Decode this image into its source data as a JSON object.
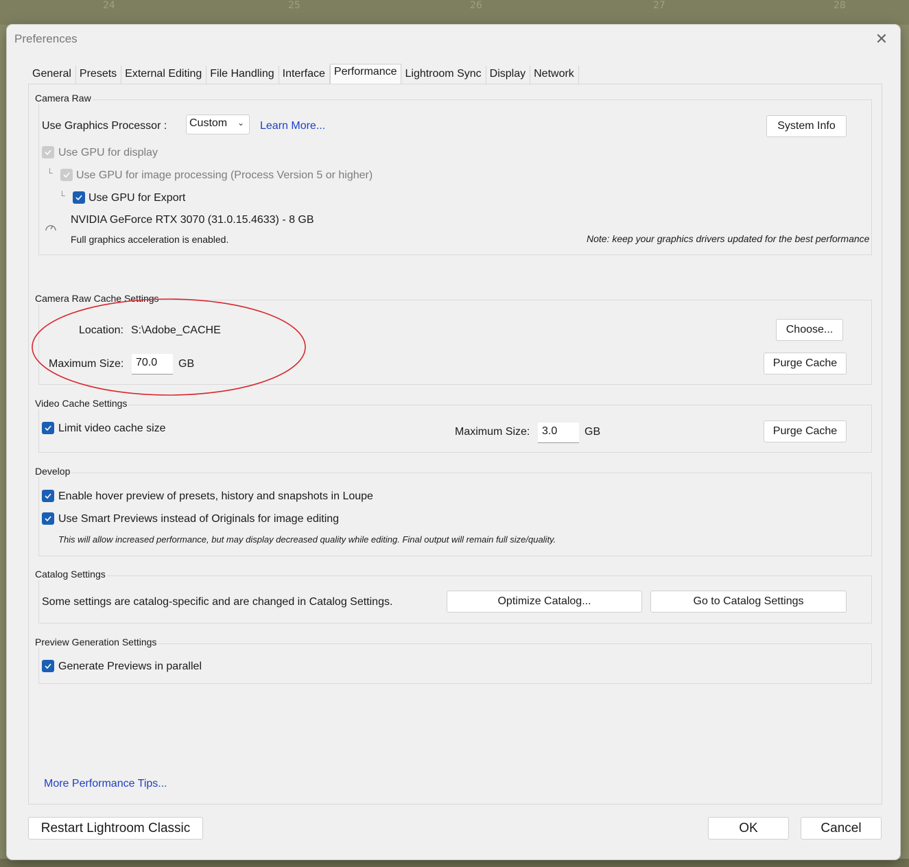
{
  "dialog": {
    "title": "Preferences"
  },
  "tabs": [
    "General",
    "Presets",
    "External Editing",
    "File Handling",
    "Interface",
    "Performance",
    "Lightroom Sync",
    "Display",
    "Network"
  ],
  "camera_raw": {
    "label": "Camera Raw",
    "gpu_label": "Use Graphics Processor :",
    "gpu_value": "Custom",
    "learn_more": "Learn More...",
    "system_info": "System Info",
    "use_gpu_display": "Use GPU for display",
    "use_gpu_processing": "Use GPU for image processing (Process Version 5 or higher)",
    "use_gpu_export": "Use GPU for Export",
    "gpu_name": "NVIDIA GeForce RTX 3070 (31.0.15.4633) - 8 GB",
    "accel_status": "Full graphics acceleration is enabled.",
    "note": "Note: keep your graphics drivers updated for the best performance"
  },
  "cache": {
    "label": "Camera Raw Cache Settings",
    "location_label": "Location:",
    "location_value": "S:\\Adobe_CACHE",
    "choose": "Choose...",
    "max_label": "Maximum Size:",
    "max_value": "70.0",
    "unit": "GB",
    "purge": "Purge Cache"
  },
  "video_cache": {
    "label": "Video Cache Settings",
    "limit": "Limit video cache size",
    "max_label": "Maximum Size:",
    "max_value": "3.0",
    "unit": "GB",
    "purge": "Purge Cache"
  },
  "develop": {
    "label": "Develop",
    "hover": "Enable hover preview of presets, history and snapshots in Loupe",
    "smart": "Use Smart Previews instead of Originals for image editing",
    "smart_note": "This will allow increased performance, but may display decreased quality while editing. Final output will remain full size/quality."
  },
  "catalog": {
    "label": "Catalog Settings",
    "text": "Some settings are catalog-specific and are changed in Catalog Settings.",
    "optimize": "Optimize Catalog...",
    "goto": "Go to Catalog Settings"
  },
  "preview": {
    "label": "Preview Generation Settings",
    "parallel": "Generate Previews in parallel"
  },
  "footer": {
    "tips": "More Performance Tips...",
    "restart": "Restart Lightroom Classic",
    "ok": "OK",
    "cancel": "Cancel"
  },
  "background": {
    "frame_numbers": [
      "24",
      "25",
      "26",
      "27",
      "28"
    ]
  },
  "colors": {
    "accent": "#1a5fb4",
    "annotation": "#d9262d",
    "link": "#1f3fc4"
  }
}
